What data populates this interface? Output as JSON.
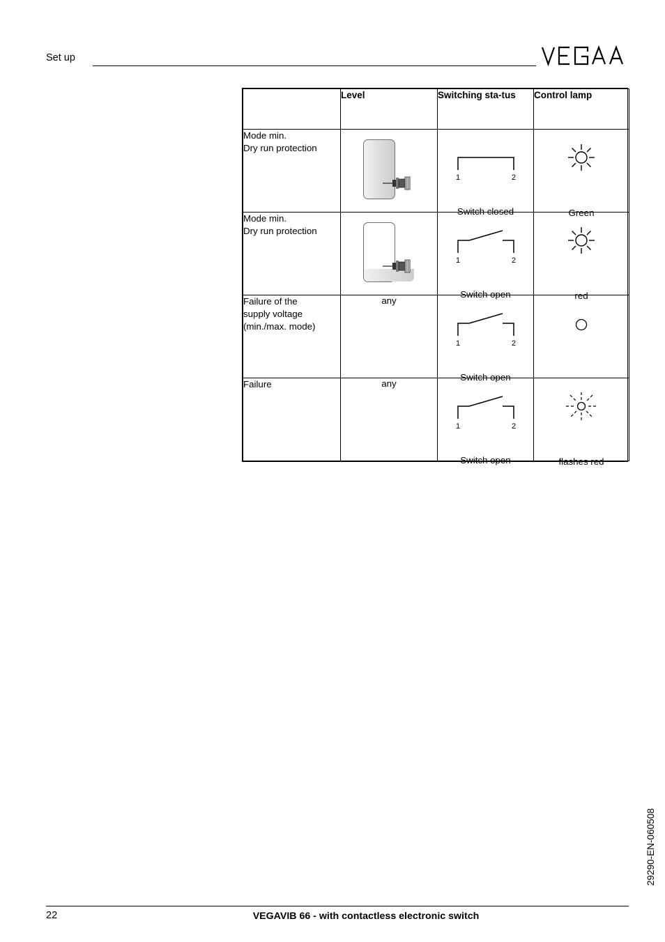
{
  "header": {
    "title": "Set up",
    "logo_text": "VEGA"
  },
  "table": {
    "columns": [
      "",
      "Level",
      "Switching sta-\ntus",
      "Control lamp"
    ],
    "headers": {
      "blank": "",
      "level": "Level",
      "switching_status": "Switching sta-tus",
      "control_lamp": "Control lamp"
    },
    "rows": [
      {
        "mode": "Mode min.\nDry run protection",
        "mode_line1": "Mode min.",
        "mode_line2": "Dry run protection",
        "level_icon": "vessel-full",
        "level_text": "",
        "switch_icon": "switch-closed-symbol",
        "switch_terminal_1": "1",
        "switch_terminal_2": "2",
        "switch_caption": "Switch closed",
        "lamp_icon": "lamp-on-icon",
        "lamp_caption": "Green"
      },
      {
        "mode": "Mode min.\nDry run protection",
        "mode_line1": "Mode min.",
        "mode_line2": "Dry run protection",
        "level_icon": "vessel-low",
        "level_text": "",
        "switch_icon": "switch-open-symbol",
        "switch_terminal_1": "1",
        "switch_terminal_2": "2",
        "switch_caption": "Switch open",
        "lamp_icon": "lamp-on-icon",
        "lamp_caption": "red"
      },
      {
        "mode": "Failure of the\nsupply voltage\n(min./max. mode)",
        "mode_line1": "Failure of the",
        "mode_line2": "supply voltage",
        "mode_line3": "(min./max. mode)",
        "level_icon": "",
        "level_text": "any",
        "switch_icon": "switch-open-symbol",
        "switch_terminal_1": "1",
        "switch_terminal_2": "2",
        "switch_caption": "Switch open",
        "lamp_icon": "lamp-off-icon",
        "lamp_caption": ""
      },
      {
        "mode": "Failure",
        "mode_line1": "Failure",
        "level_icon": "",
        "level_text": "any",
        "switch_icon": "switch-open-symbol",
        "switch_terminal_1": "1",
        "switch_terminal_2": "2",
        "switch_caption": "Switch open",
        "lamp_icon": "lamp-flashing-icon",
        "lamp_caption": "flashes red"
      }
    ]
  },
  "footer": {
    "page_number": "22",
    "document_title": "VEGAVIB 66 - with contactless electronic switch",
    "doc_number": "29290-EN-060508"
  }
}
